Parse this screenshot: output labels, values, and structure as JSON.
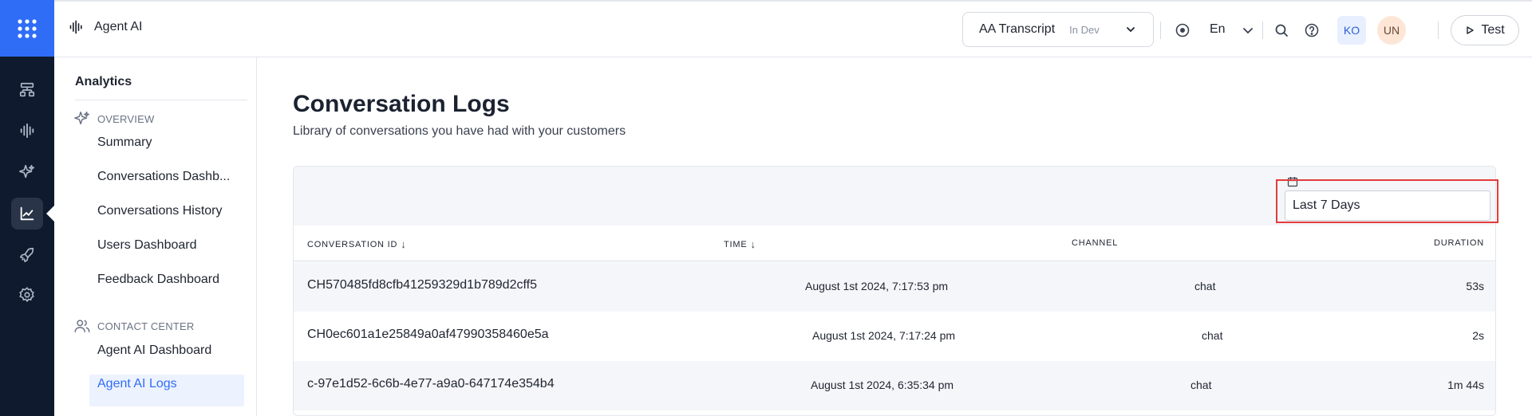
{
  "header": {
    "brand_label": "Agent AI",
    "app_name": "AA Transcript",
    "app_env": "In Dev",
    "language": "En",
    "avatar_ko": "KO",
    "avatar_un": "UN",
    "test_label": "Test"
  },
  "sidebar": {
    "title": "Analytics",
    "sections": [
      {
        "label": "OVERVIEW",
        "icon": "sparkle-icon"
      },
      {
        "label": "CONTACT CENTER",
        "icon": "users-icon"
      }
    ],
    "items": [
      "Summary",
      "Conversations Dashb...",
      "Conversations History",
      "Users Dashboard",
      "Feedback Dashboard",
      "Agent AI Dashboard",
      "Agent AI Logs"
    ]
  },
  "page": {
    "title": "Conversation Logs",
    "subtitle": "Library of conversations you have had with your customers"
  },
  "filter": {
    "range_value": "Last 7 Days",
    "icon": "calendar-icon"
  },
  "table": {
    "columns": [
      "CONVERSATION ID",
      "TIME",
      "CHANNEL",
      "DURATION"
    ],
    "sort_arrow": "↓",
    "rows": [
      {
        "id": "CH570485fd8cfb41259329d1b789d2cff5",
        "time": "August 1st 2024, 7:17:53 pm",
        "channel": "chat",
        "duration": "53s"
      },
      {
        "id": "CH0ec601a1e25849a0af47990358460e5a",
        "time": "August 1st 2024, 7:17:24 pm",
        "channel": "chat",
        "duration": "2s"
      },
      {
        "id": "c-97e1d52-6c6b-4e77-a9a0-647174e354b4",
        "time": "August 1st 2024, 6:35:34 pm",
        "channel": "chat",
        "duration": "1m 44s"
      }
    ]
  },
  "colors": {
    "rail_bg": "#0f1a2e",
    "rail_accent": "#2f6df6",
    "active_item": "#2f6df6",
    "highlight": "#e43b3b"
  }
}
